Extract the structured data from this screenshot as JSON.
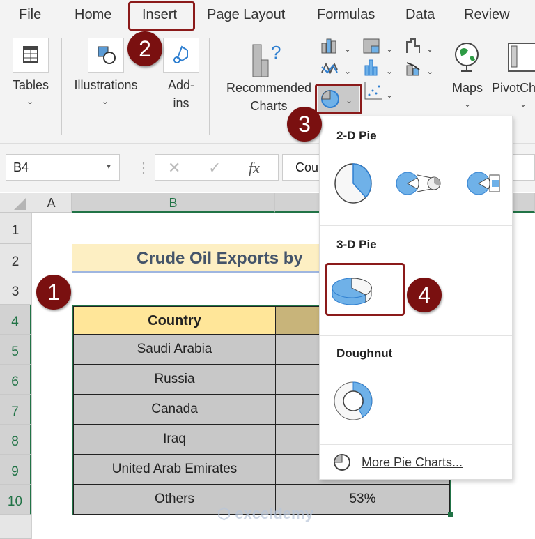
{
  "ribbon_tabs": [
    "File",
    "Home",
    "Insert",
    "Page Layout",
    "Formulas",
    "Data",
    "Review"
  ],
  "active_tab": "Insert",
  "ribbon": {
    "tables": "Tables",
    "illustrations": "Illustrations",
    "addins_1": "Add-",
    "addins_2": "ins",
    "recommended_1": "Recommended",
    "recommended_2": "Charts",
    "maps": "Maps",
    "pivotchart": "PivotCh"
  },
  "formula_bar": {
    "name_box": "B4",
    "formula": "Cou",
    "fx": "fx"
  },
  "columns": [
    "A",
    "B"
  ],
  "rows": [
    "1",
    "2",
    "3",
    "4",
    "5",
    "6",
    "7",
    "8",
    "9",
    "10"
  ],
  "sheet": {
    "title": "Crude Oil Exports by",
    "header": "Country",
    "countries": [
      "Saudi Arabia",
      "Russia",
      "Canada",
      "Iraq",
      "United Arab Emirates",
      "Others"
    ],
    "last_value": "53%"
  },
  "menu": {
    "pie2d": "2-D Pie",
    "pie3d": "3-D Pie",
    "doughnut": "Doughnut",
    "more": "More Pie Charts..."
  },
  "badges": [
    "1",
    "2",
    "3",
    "4"
  ],
  "watermark": "exceldemy EXCEL · DATA · BI",
  "colors": {
    "accent": "#217346",
    "badge": "#7a1010",
    "chart_blue": "#6fb1e8",
    "title_bg": "#fdefc3",
    "header_bg": "#ffe699"
  }
}
